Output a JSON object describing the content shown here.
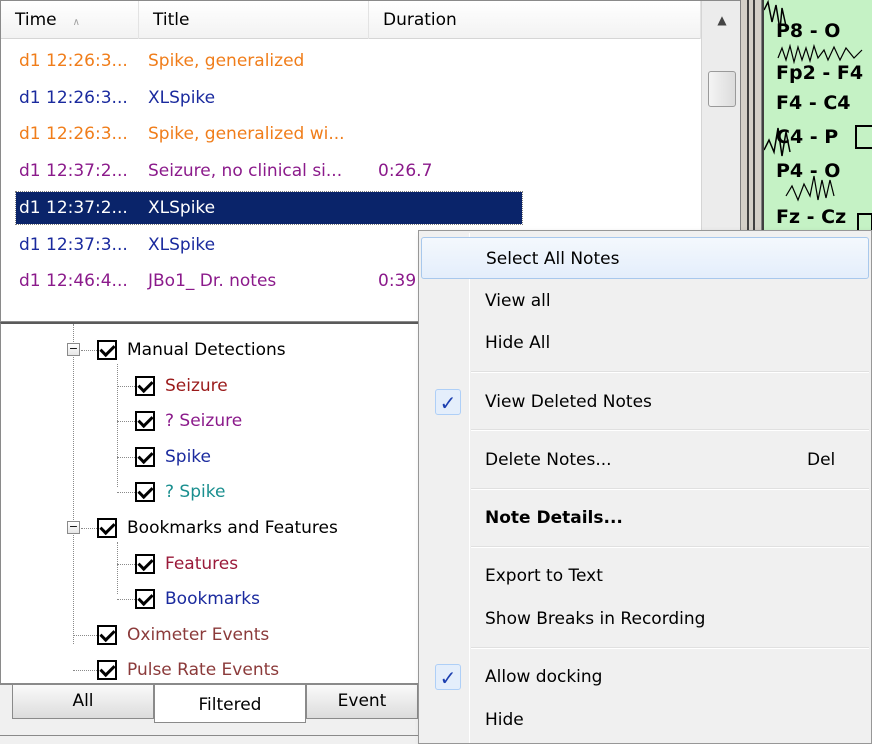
{
  "notes_list": {
    "columns": {
      "time": "Time",
      "title": "Title",
      "duration": "Duration"
    },
    "sort_indicator": "∧",
    "rows": [
      {
        "time": "d1 12:26:3...",
        "title": "Spike, generalized",
        "duration": "",
        "color": "#f07d1a"
      },
      {
        "time": "d1 12:26:3...",
        "title": "XLSpike",
        "duration": "",
        "color": "#1a2a9e"
      },
      {
        "time": "d1 12:26:3...",
        "title": "Spike, generalized wi...",
        "duration": "",
        "color": "#f07d1a"
      },
      {
        "time": "d1 12:37:2...",
        "title": "Seizure, no clinical si...",
        "duration": "0:26.7",
        "color": "#8b1a8b"
      },
      {
        "time": "d1 12:37:2...",
        "title": "XLSpike",
        "duration": "",
        "color": "#ffffff",
        "selected": true
      },
      {
        "time": "d1 12:37:3...",
        "title": "XLSpike",
        "duration": "",
        "color": "#1a2a9e"
      },
      {
        "time": "d1 12:46:4...",
        "title": "JBo1_ Dr. notes",
        "duration": "0:39",
        "color": "#8b1a8b"
      }
    ]
  },
  "eeg": {
    "channels": [
      "P8 - O",
      "Fp2 - F4",
      "F4 - C4",
      "C4 - P",
      "P4 - O",
      "Fz - Cz"
    ],
    "background": "#c5f2c5"
  },
  "tree": {
    "groups": [
      {
        "label": "Manual Detections",
        "color": "#000000",
        "children": [
          {
            "label": "Seizure",
            "color": "#9a1a1a"
          },
          {
            "label": "? Seizure",
            "color": "#8b1a8b"
          },
          {
            "label": "Spike",
            "color": "#1a2a9e"
          },
          {
            "label": "? Spike",
            "color": "#1a8f8f"
          }
        ]
      },
      {
        "label": "Bookmarks and Features",
        "color": "#000000",
        "children": [
          {
            "label": "Features",
            "color": "#9a1a3a"
          },
          {
            "label": "Bookmarks",
            "color": "#1a2a9e"
          }
        ]
      }
    ],
    "standalone": [
      {
        "label": "Oximeter Events",
        "color": "#8b3a3a"
      },
      {
        "label": "Pulse Rate Events",
        "color": "#8b3a3a"
      }
    ],
    "expander_symbol": "−"
  },
  "tabs": [
    {
      "label": "All",
      "active": false
    },
    {
      "label": "Filtered",
      "active": true
    },
    {
      "label": "Event",
      "active": false
    }
  ],
  "context_menu": {
    "items": [
      {
        "label": "Select All Notes",
        "hover": true
      },
      {
        "label": "View all"
      },
      {
        "label": "Hide All"
      },
      {
        "separator": true
      },
      {
        "label": "View Deleted Notes",
        "checked": true
      },
      {
        "separator": true
      },
      {
        "label": "Delete Notes...",
        "shortcut": "Del"
      },
      {
        "separator": true
      },
      {
        "label": "Note Details...",
        "bold": true
      },
      {
        "separator": true
      },
      {
        "label": "Export to Text"
      },
      {
        "label": "Show Breaks in Recording"
      },
      {
        "separator": true
      },
      {
        "label": "Allow docking",
        "checked": true
      },
      {
        "label": "Hide"
      }
    ],
    "check_glyph": "✓"
  },
  "icons": {
    "scroll_up": "scroll-up-arrow-icon",
    "expander": "collapse-minus-icon",
    "checkbox": "checked-checkbox-icon",
    "menu_check": "checkmark-icon"
  }
}
